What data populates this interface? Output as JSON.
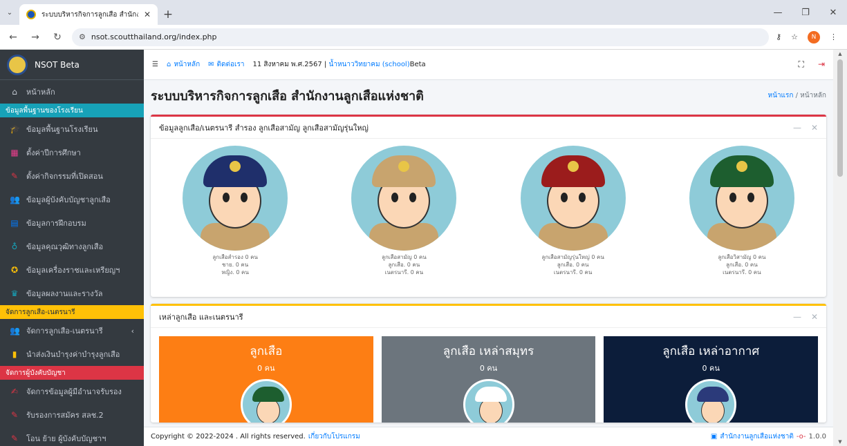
{
  "browser": {
    "tab_title": "ระบบบริหารกิจการลูกเสือ สำนักงานลู",
    "url": "nsot.scoutthailand.org/index.php",
    "profile_initial": "N"
  },
  "sidebar": {
    "brand": "NSOT Beta",
    "home": "หน้าหลัก",
    "header_school": "ข้อมูลพื้นฐานของโรงเรียน",
    "school_items": [
      {
        "label": "ข้อมูลพื้นฐานโรงเรียน",
        "icon": "graduation-cap-icon",
        "color": "#17a2b8"
      },
      {
        "label": "ตั้งค่าปีการศึกษา",
        "icon": "calendar-icon",
        "color": "#e83e8c"
      },
      {
        "label": "ตั้งค่ากิจกรรมที่เปิดสอน",
        "icon": "edit-icon",
        "color": "#dc3545"
      },
      {
        "label": "ข้อมูลผู้บังคับบัญชาลูกเสือ",
        "icon": "users-icon",
        "color": "#17a2b8"
      },
      {
        "label": "ข้อมูลการฝึกอบรม",
        "icon": "id-card-icon",
        "color": "#007bff"
      },
      {
        "label": "ข้อมูลคุณวุฒิทางลูกเสือ",
        "icon": "medal-icon",
        "color": "#17a2b8"
      },
      {
        "label": "ข้อมูลเครื่องราชและเหรียญฯ",
        "icon": "award-icon",
        "color": "#ffc107"
      },
      {
        "label": "ข้อมูลผลงานและรางวัล",
        "icon": "trophy-icon",
        "color": "#17a2b8"
      }
    ],
    "header_scouts": "จัดการลูกเสือ-เนตรนารี",
    "scout_items": [
      {
        "label": "จัดการลูกเสือ-เนตรนารี",
        "icon": "users-icon",
        "color": "#ffc107"
      },
      {
        "label": "นำส่งเงินบำรุงค่าบำรุงลูกเสือ",
        "icon": "file-icon",
        "color": "#ffc107"
      }
    ],
    "header_commanders": "จัดการผู้บังคับบัญชา",
    "commander_items": [
      {
        "label": "จัดการข้อมูลผู้มีอำนาจรับรอง",
        "icon": "user-edit-icon",
        "color": "#dc3545"
      },
      {
        "label": "รับรองการสมัคร สลช.2",
        "icon": "edit-icon",
        "color": "#dc3545"
      },
      {
        "label": "โอน ย้าย ผู้บังคับบัญชาฯ",
        "icon": "edit-icon",
        "color": "#dc3545"
      }
    ]
  },
  "topnav": {
    "home": "หน้าหลัก",
    "contact": "ติดต่อเรา",
    "date": "11 สิงหาคม พ.ศ.2567 |",
    "school": "น้ำหนาววิทยาคม (school)",
    "beta": "Beta"
  },
  "header": {
    "title": "ระบบบริหารกิจการลูกเสือ สำนักงานลูกเสือแห่งชาติ",
    "breadcrumb_home": "หน้าแรก",
    "breadcrumb_sep": " / ",
    "breadcrumb_current": "หน้าหลัก"
  },
  "card1": {
    "title": "ข้อมูลลูกเสือ/เนตรนารี สำรอง ลูกเสือสามัญ ลูกเสือสามัญรุ่นใหญ่",
    "scouts": [
      {
        "line1": "ลูกเสือสำรอง 0 คน",
        "line2": "ชาย. 0 คน",
        "line3": "หญิง. 0 คน",
        "hat_color": "#1f2f6b"
      },
      {
        "line1": "ลูกเสือสามัญ 0 คน",
        "line2": "ลูกเสือ. 0 คน",
        "line3": "เนตรนารี. 0 คน",
        "hat_color": "#c8a46e"
      },
      {
        "line1": "ลูกเสือสามัญรุ่นใหญ่ 0 คน",
        "line2": "ลูกเสือ. 0 คน",
        "line3": "เนตรนารี. 0 คน",
        "hat_color": "#9b1c1c"
      },
      {
        "line1": "ลูกเสือวิสามัญ 0 คน",
        "line2": "ลูกเสือ. 0 คน",
        "line3": "เนตรนารี. 0 คน",
        "hat_color": "#1d5e2f"
      }
    ]
  },
  "card2": {
    "title": "เหล่าลูกเสือ และเนตรนารี",
    "branches": [
      {
        "title": "ลูกเสือ",
        "count": "0 คน",
        "bg": "#fd7e14",
        "hat_color": "#1d5e2f"
      },
      {
        "title": "ลูกเสือ เหล่าสมุทร",
        "count": "0 คน",
        "bg": "#6c757d",
        "hat_color": "#ffffff"
      },
      {
        "title": "ลูกเสือ เหล่าอากาศ",
        "count": "0 คน",
        "bg": "#0c1d3a",
        "hat_color": "#2b3a7a"
      }
    ]
  },
  "footer": {
    "copyright": "Copyright © 2022-2024 . All rights reserved.",
    "about": "เกี่ยวกับโปรแกรม",
    "org": "สำนักงานลูกเสือแห่งชาติ",
    "version": "1.0.0"
  }
}
